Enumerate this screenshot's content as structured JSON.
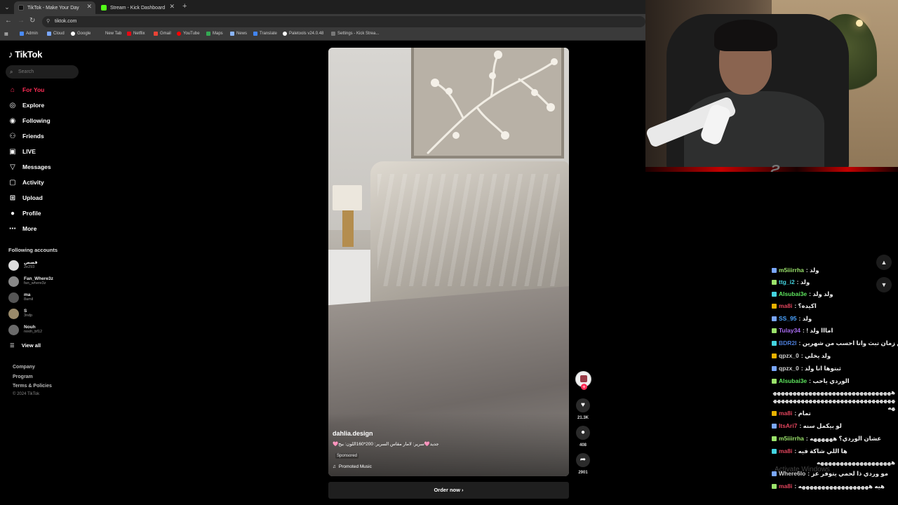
{
  "browser": {
    "tabs": [
      {
        "title": "TikTok - Make Your Day",
        "active": true
      },
      {
        "title": "Stream - Kick Dashboard",
        "active": false
      }
    ],
    "new_tab": "+",
    "url": "tiktok.com",
    "bookmarks": [
      "Admin",
      "Cloud",
      "Google",
      "New Tab",
      "Netflix",
      "Gmail",
      "YouTube",
      "Maps",
      "News",
      "Translate",
      "Paletools v24.0.48",
      "Settings - Kick Strea..."
    ]
  },
  "tiktok": {
    "logo": "TikTok",
    "search_placeholder": "Search",
    "nav": [
      {
        "label": "For You",
        "icon": "home-icon",
        "active": true
      },
      {
        "label": "Explore",
        "icon": "compass-icon"
      },
      {
        "label": "Following",
        "icon": "following-icon"
      },
      {
        "label": "Friends",
        "icon": "friends-icon"
      },
      {
        "label": "LIVE",
        "icon": "live-icon"
      },
      {
        "label": "Messages",
        "icon": "messages-icon"
      },
      {
        "label": "Activity",
        "icon": "activity-icon"
      },
      {
        "label": "Upload",
        "icon": "upload-icon"
      },
      {
        "label": "Profile",
        "icon": "profile-icon"
      },
      {
        "label": "More",
        "icon": "more-icon"
      }
    ],
    "following_label": "Following accounts",
    "accounts": [
      {
        "name": "قصص",
        "handle": "2e293"
      },
      {
        "name": "Fan_Where3z",
        "handle": "fan_where3z"
      },
      {
        "name": "ma",
        "handle": "8amil"
      },
      {
        "name": "S",
        "handle": "3ndp"
      },
      {
        "name": "Nouh",
        "handle": "nooh_bf12"
      }
    ],
    "view_all": "View all",
    "footer": [
      "Company",
      "Program",
      "Terms & Policies"
    ],
    "copyright": "© 2024 TikTok"
  },
  "video": {
    "author": "dahlia.design",
    "caption": "جديد🩷سرير: لامار مقاس السرير: 200*160اللون: بيج🩷",
    "sponsored": "Sponsored",
    "music": "Promoted Music",
    "order_button": "Order now",
    "likes": "21.3K",
    "comments": "408",
    "shares": "2901"
  },
  "chat": {
    "messages": [
      {
        "user": "m5iiirrha",
        "text": "ولد :",
        "color": "#9be36b"
      },
      {
        "user": "ttg_i2",
        "text": "ولد :",
        "color": "#44d4e0"
      },
      {
        "user": "Alsubai3e",
        "text": "ولد ولد :",
        "color": "#5de35d"
      },
      {
        "user": "ma8i",
        "text": "اكيده؟ :",
        "color": "#e0445c"
      },
      {
        "user": "SS_95",
        "text": "ولد :",
        "color": "#4aa3ff"
      },
      {
        "user": "Tulay34",
        "text": "امااا ولد ! :",
        "color": "#a86cf0"
      },
      {
        "user": "BDR2I",
        "text": "ماشاءالله من زمان تبث وانا احسب من شهرين :",
        "color": "#4a7bd6"
      },
      {
        "user": "qpzx_0",
        "text": "ولد يخلي :",
        "color": "#cfcfcf"
      },
      {
        "user": "qpzx_0",
        "text": "ثبتوها انا ولد :",
        "color": "#cfcfcf"
      },
      {
        "user": "Alsubai3e",
        "text": "الوردي ياحب :",
        "color": "#5de35d"
      },
      {
        "user": "",
        "text": "هههههههههههههههههههههههههههههههههههههههههههههههههههههههههههههههه",
        "color": "#eee"
      },
      {
        "user": "ma8i",
        "text": "تمام :",
        "color": "#e0445c"
      },
      {
        "user": "ItsAri7",
        "text": "لو بيكمل سنه :",
        "color": "#e0445c"
      },
      {
        "user": "m5iiirrha",
        "text": "عشان الوردي؟ ههههههه :",
        "color": "#9be36b"
      },
      {
        "user": "ma8i",
        "text": "ها اللي شاكة فيه :",
        "color": "#e0445c"
      },
      {
        "user": "",
        "text": "هههههههههههههههههههه",
        "color": "#eee"
      },
      {
        "user": "Where6lo",
        "text": "مو وردي ذا لحمي يتوفر عز :",
        "color": "#cfcfcf"
      },
      {
        "user": "ma8i",
        "text": "هيه ههههههههههههههههههه :",
        "color": "#e0445c"
      }
    ]
  },
  "watermark": "Activate Windows"
}
